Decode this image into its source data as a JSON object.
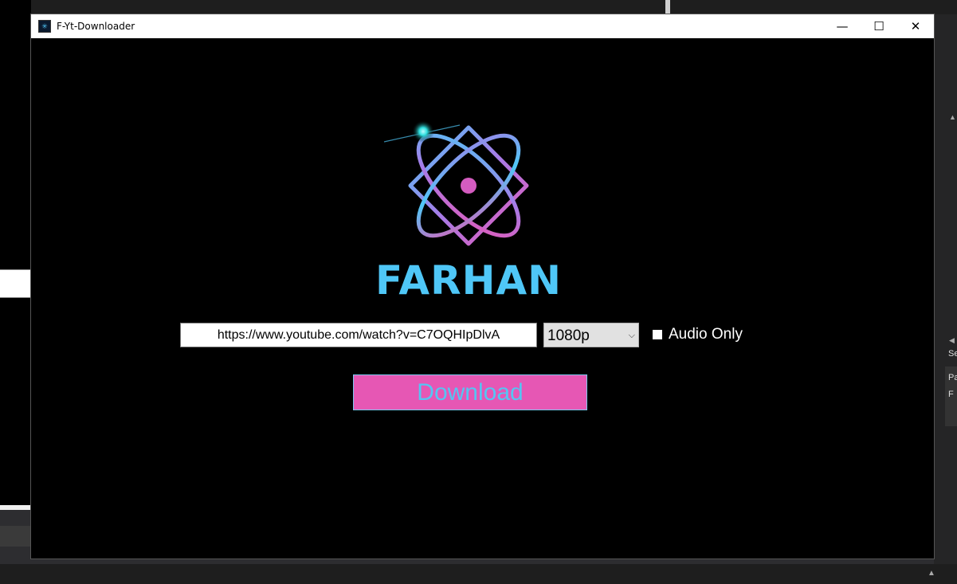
{
  "window": {
    "title": "F-Yt-Downloader",
    "icon": "app-icon",
    "controls": {
      "minimize": "—",
      "maximize": "☐",
      "close": "✕"
    }
  },
  "brand": {
    "name": "FARHAN",
    "logo": "atom-logo",
    "colors": {
      "primary": "#4fc7f7",
      "accent": "#e657b4",
      "secondary": "#a67ce8"
    }
  },
  "form": {
    "url_value": "https://www.youtube.com/watch?v=C7OQHIpDlvA",
    "quality_selected": "1080p",
    "quality_arrow": "chevron-down",
    "audio_only_label": "Audio Only",
    "audio_only_checked": false,
    "download_label": "Download"
  },
  "background": {
    "right_panel_letters": [
      "Se",
      "Pa",
      "F"
    ]
  }
}
